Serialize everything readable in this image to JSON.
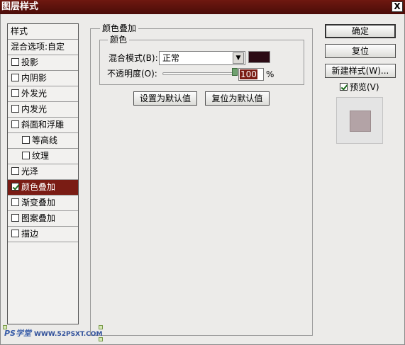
{
  "window": {
    "title": "图层样式",
    "close_label": "X"
  },
  "style_list": {
    "header": "样式",
    "blend_options": "混合选项:自定",
    "items": [
      {
        "label": "投影",
        "checked": false
      },
      {
        "label": "内阴影",
        "checked": false
      },
      {
        "label": "外发光",
        "checked": false
      },
      {
        "label": "内发光",
        "checked": false
      },
      {
        "label": "斜面和浮雕",
        "checked": false
      },
      {
        "label": "等高线",
        "checked": false
      },
      {
        "label": "纹理",
        "checked": false
      },
      {
        "label": "光泽",
        "checked": false
      },
      {
        "label": "颜色叠加",
        "checked": true,
        "selected": true
      },
      {
        "label": "渐变叠加",
        "checked": false
      },
      {
        "label": "图案叠加",
        "checked": false
      },
      {
        "label": "描边",
        "checked": false
      }
    ]
  },
  "panel": {
    "title": "颜色叠加",
    "group_title": "颜色",
    "blend_mode_label": "混合模式(B):",
    "blend_mode_value": "正常",
    "overlay_color": "#2b0a14",
    "opacity_label": "不透明度(O):",
    "opacity_value": "100",
    "opacity_unit": "%",
    "opacity_percent": 100,
    "set_default_button": "设置为默认值",
    "reset_default_button": "复位为默认值"
  },
  "actions": {
    "ok": "确定",
    "reset": "复位",
    "new_style": "新建样式(W)...",
    "preview_label": "预览(V)",
    "preview_checked": true,
    "preview_color": "#b3a3a6"
  },
  "watermark": {
    "logo_text": "PS学堂",
    "site": "WWW.52PSXT.COM"
  }
}
